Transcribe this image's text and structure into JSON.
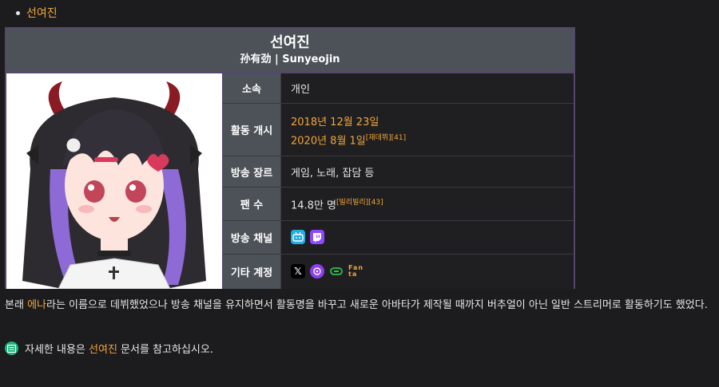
{
  "top_link": "선여진",
  "infobox": {
    "title": "선여진",
    "subtitle": "孙有劲 | Sunyeojin",
    "rows": [
      {
        "label": "소속",
        "value": "개인"
      },
      {
        "label": "활동 개시",
        "line1": "2018년 12월 23일",
        "line2": "2020년 8월 1일",
        "line2_ref1": "[재데뷔]",
        "line2_ref2": "[41]"
      },
      {
        "label": "방송 장르",
        "value": "게임, 노래, 잡담 등"
      },
      {
        "label": "팬 수",
        "value": "14.8만 명",
        "ref1": "[빌리빌리]",
        "ref2": "[43]"
      },
      {
        "label": "방송 채널",
        "icons": [
          "bilibili-icon",
          "twitch-icon"
        ]
      },
      {
        "label": "기타 계정",
        "icons": [
          "x-icon",
          "afreecatv-icon",
          "link-icon"
        ],
        "fanta_text": "Fan ta"
      }
    ]
  },
  "paragraph": {
    "before": "본래 ",
    "link": "에나",
    "after": "라는 이름으로 데뷔했었으나 방송 채널을 유지하면서 활동명을 바꾸고 새로운 아바타가 제작될 때까지 버추얼이 아닌 일반 스트리머로 활동하기도 했었다."
  },
  "see_also": {
    "before": "자세한 내용은 ",
    "link": "선여진",
    "after": " 문서를 참고하십시오."
  },
  "colors": {
    "link": "#f0a63a",
    "header_bg": "#4c5257",
    "border": "#55466e",
    "bilibili": "#23ade5",
    "twitch": "#9146ff"
  }
}
